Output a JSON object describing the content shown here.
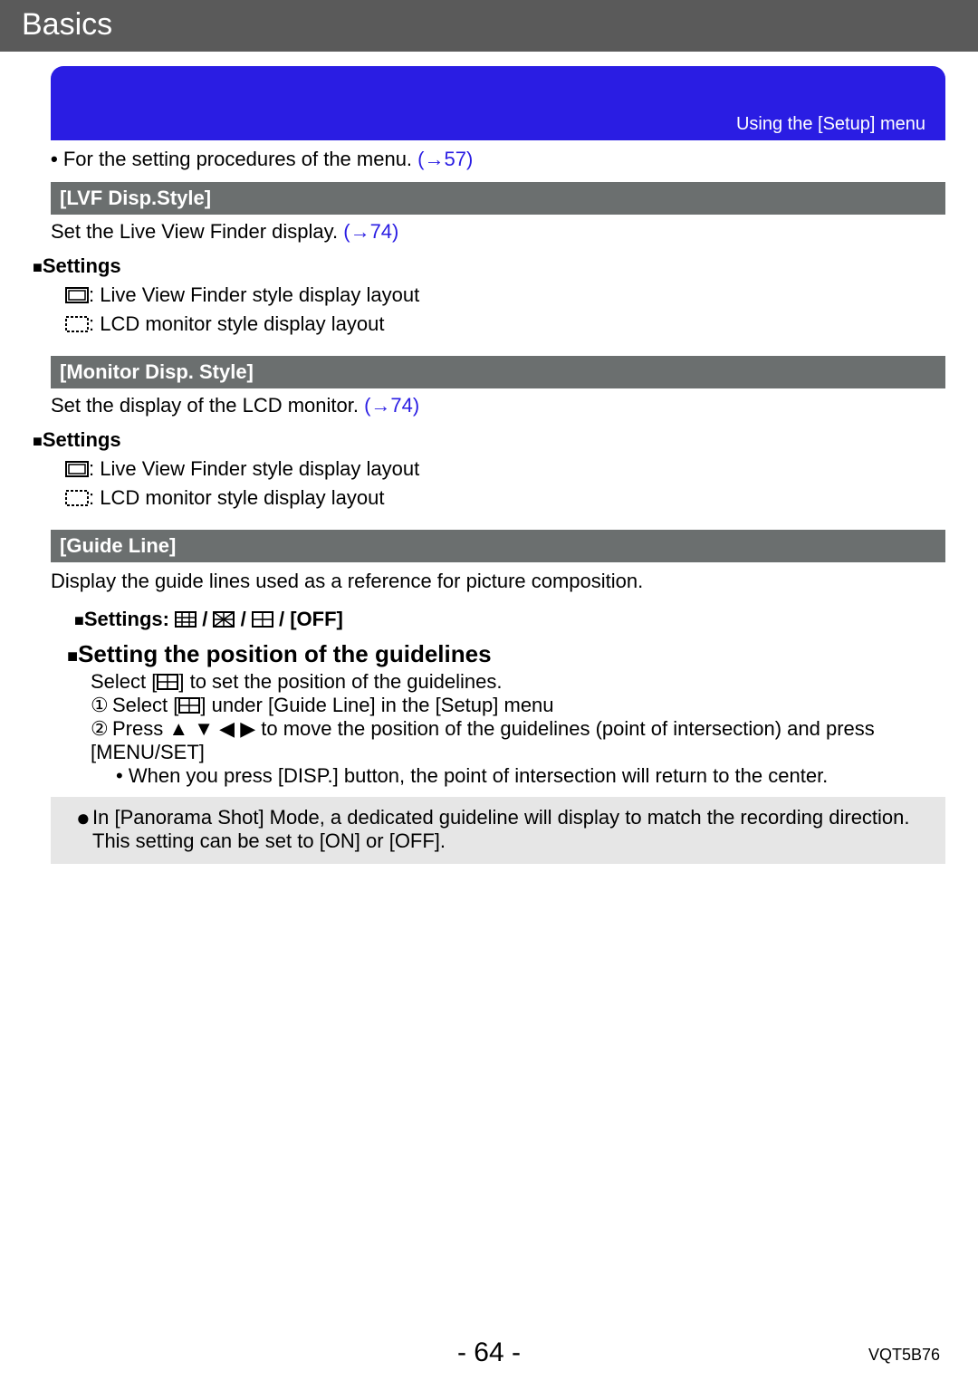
{
  "header": {
    "title": "Basics"
  },
  "banner": {
    "rightLabel": "Using the [Setup] menu"
  },
  "intro": {
    "bullet": "• ",
    "text": "For the setting procedures of the menu. ",
    "link": "(→57)"
  },
  "sections": {
    "lvf": {
      "title": "[LVF Disp.Style]",
      "desc": "Set the Live View Finder display. ",
      "link": "(→74)",
      "settingsLabel": "Settings",
      "opt1": ": Live View Finder style display layout",
      "opt2": ": LCD monitor style display layout"
    },
    "monitor": {
      "title": "[Monitor Disp. Style]",
      "desc": "Set the display of the LCD monitor. ",
      "link": "(→74)",
      "settingsLabel": "Settings",
      "opt1": ": Live View Finder style display layout",
      "opt2": ": LCD monitor style display layout"
    },
    "guide": {
      "title": "[Guide Line]",
      "desc": "Display the guide lines used as a reference for picture composition.",
      "settingsLabel": "Settings: ",
      "slash": " / ",
      "off": "[OFF]",
      "posHeading": "Setting the position of the guidelines",
      "selectPrefix": "Select [",
      "selectSuffix": "] to set the position of the guidelines.",
      "step1num": "①",
      "step1a": "Select [",
      "step1b": "] under [Guide Line] in the [Setup] menu",
      "step2num": "②",
      "step2a": "Press ",
      "step2b": " to move the position of the guidelines (point of intersection) and press [MENU/SET]",
      "noteBullet": "• ",
      "note": "When you press [DISP.] button, the point of intersection will return to the center."
    }
  },
  "panorama": {
    "bullet": "●",
    "line1": "In [Panorama Shot] Mode, a dedicated guideline will display to match the recording direction.",
    "line2": "This setting can be set to [ON] or [OFF]."
  },
  "footer": {
    "page": "- 64 -",
    "doc": "VQT5B76"
  }
}
